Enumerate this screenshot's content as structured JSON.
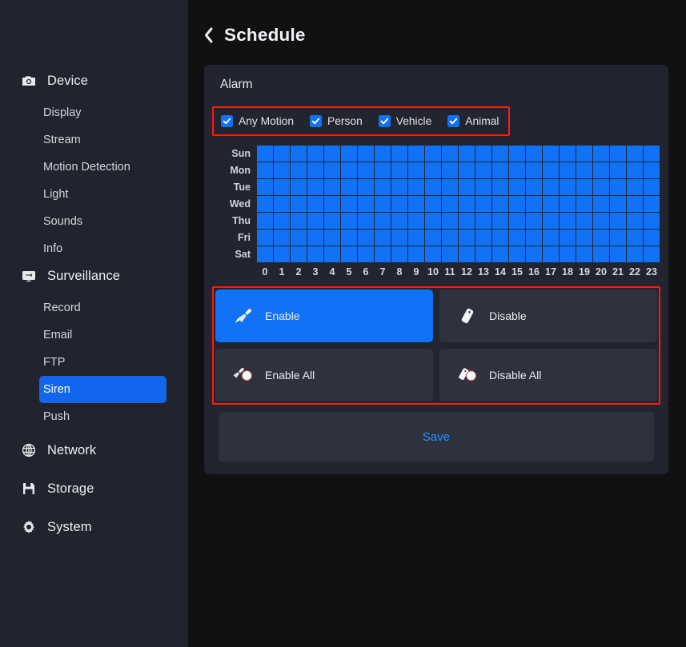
{
  "sidebar": {
    "groups": [
      {
        "label": "Device",
        "icon": "camera-icon",
        "items": [
          "Display",
          "Stream",
          "Motion Detection",
          "Light",
          "Sounds",
          "Info"
        ]
      },
      {
        "label": "Surveillance",
        "icon": "monitor-icon",
        "items": [
          "Record",
          "Email",
          "FTP",
          "Siren",
          "Push"
        ]
      },
      {
        "label": "Network",
        "icon": "globe-icon",
        "items": []
      },
      {
        "label": "Storage",
        "icon": "save-disk-icon",
        "items": []
      },
      {
        "label": "System",
        "icon": "gear-icon",
        "items": []
      }
    ],
    "active_item": "Siren"
  },
  "header": {
    "back_icon": "chevron-left-icon",
    "title": "Schedule"
  },
  "card": {
    "title": "Alarm",
    "checkboxes": [
      {
        "label": "Any Motion",
        "checked": true
      },
      {
        "label": "Person",
        "checked": true
      },
      {
        "label": "Vehicle",
        "checked": true
      },
      {
        "label": "Animal",
        "checked": true
      }
    ],
    "schedule": {
      "days": [
        "Sun",
        "Mon",
        "Tue",
        "Wed",
        "Thu",
        "Fri",
        "Sat"
      ],
      "hours": [
        "0",
        "1",
        "2",
        "3",
        "4",
        "5",
        "6",
        "7",
        "8",
        "9",
        "10",
        "11",
        "12",
        "13",
        "14",
        "15",
        "16",
        "17",
        "18",
        "19",
        "20",
        "21",
        "22",
        "23"
      ],
      "enabled_color": "#1272f5",
      "disabled_color": "#343845",
      "cells": [
        [
          1,
          1,
          1,
          1,
          1,
          1,
          1,
          1,
          1,
          1,
          1,
          1,
          1,
          1,
          1,
          1,
          1,
          1,
          1,
          1,
          1,
          1,
          1,
          1
        ],
        [
          1,
          1,
          1,
          1,
          1,
          1,
          1,
          1,
          1,
          1,
          1,
          1,
          1,
          1,
          1,
          1,
          1,
          1,
          1,
          1,
          1,
          1,
          1,
          1
        ],
        [
          1,
          1,
          1,
          1,
          1,
          1,
          1,
          1,
          1,
          1,
          1,
          1,
          1,
          1,
          1,
          1,
          1,
          1,
          1,
          1,
          1,
          1,
          1,
          1
        ],
        [
          1,
          1,
          1,
          1,
          1,
          1,
          1,
          1,
          1,
          1,
          1,
          1,
          1,
          1,
          1,
          1,
          1,
          1,
          1,
          1,
          1,
          1,
          1,
          1
        ],
        [
          1,
          1,
          1,
          1,
          1,
          1,
          1,
          1,
          1,
          1,
          1,
          1,
          1,
          1,
          1,
          1,
          1,
          1,
          1,
          1,
          1,
          1,
          1,
          1
        ],
        [
          1,
          1,
          1,
          1,
          1,
          1,
          1,
          1,
          1,
          1,
          1,
          1,
          1,
          1,
          1,
          1,
          1,
          1,
          1,
          1,
          1,
          1,
          1,
          1
        ],
        [
          1,
          1,
          1,
          1,
          1,
          1,
          1,
          1,
          1,
          1,
          1,
          1,
          1,
          1,
          1,
          1,
          1,
          1,
          1,
          1,
          1,
          1,
          1,
          1
        ]
      ]
    },
    "actions": [
      {
        "label": "Enable",
        "icon": "paintbrush-icon",
        "selected": true
      },
      {
        "label": "Disable",
        "icon": "eraser-icon",
        "selected": false
      },
      {
        "label": "Enable All",
        "icon": "paintbrush-all-icon",
        "selected": false
      },
      {
        "label": "Disable All",
        "icon": "eraser-all-icon",
        "selected": false
      }
    ],
    "save_label": "Save"
  },
  "colors": {
    "accent_blue": "#1272f5",
    "highlight_blue": "#1266ed",
    "save_text_blue": "#2f90fb",
    "annotation_red": "#fc1c0e",
    "sidebar_bg": "#21242e",
    "main_bg": "#111112",
    "card_bg": "#22252f",
    "button_bg": "#2d323e"
  }
}
